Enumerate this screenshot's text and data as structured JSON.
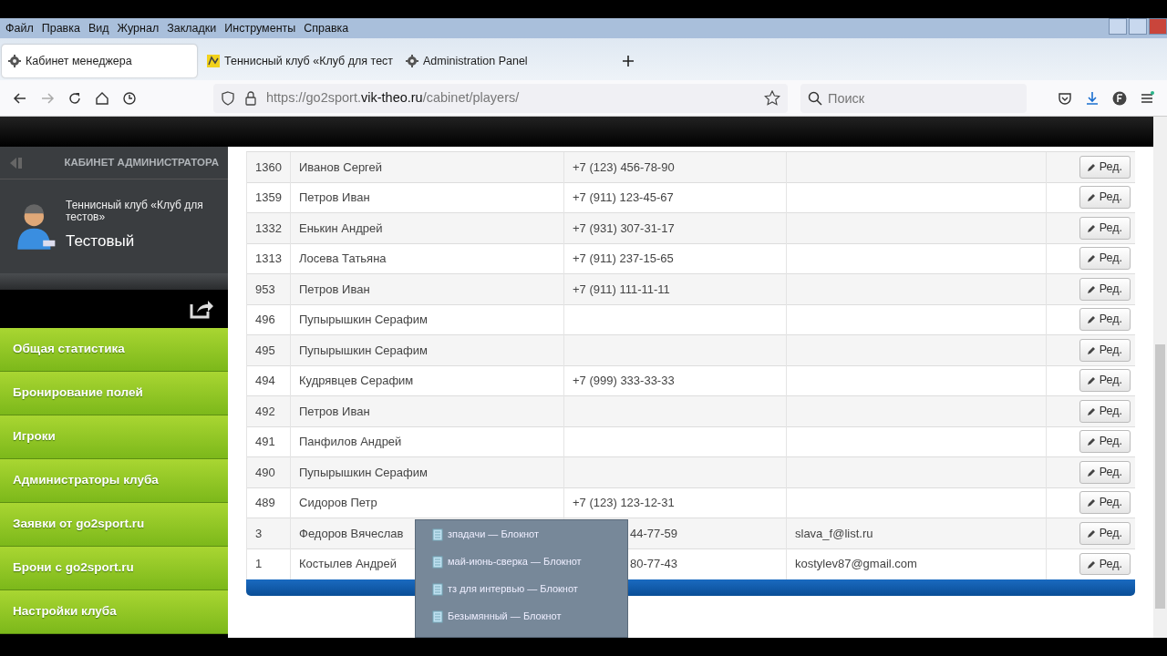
{
  "menu_bar": [
    "Файл",
    "Правка",
    "Вид",
    "Журнал",
    "Закладки",
    "Инструменты",
    "Справка"
  ],
  "tabs": [
    {
      "label": "Кабинет менеджера",
      "selected": true,
      "kind": "gear"
    },
    {
      "label": "Теннисный клуб «Клуб для тест",
      "selected": false,
      "kind": "map"
    },
    {
      "label": "Administration Panel",
      "selected": false,
      "kind": "gear"
    }
  ],
  "address": {
    "prefix": "https://go2sport.",
    "domain": "vik-theo.ru",
    "path": "/cabinet/players/"
  },
  "search": {
    "placeholder": "Поиск"
  },
  "sidebar": {
    "header": "КАБИНЕТ АДМИНИСТРАТОРА",
    "club": "Теннисный клуб «Клуб для тестов»",
    "user": "Тестовый",
    "items": [
      "Общая статистика",
      "Бронирование полей",
      "Игроки",
      "Администраторы клуба",
      "Заявки от go2sport.ru",
      "Брони с go2sport.ru",
      "Настройки клуба"
    ]
  },
  "table": {
    "rows": [
      {
        "id": "1360",
        "name": "Иванов Сергей",
        "phone": "+7 (123) 456-78-90",
        "email": "",
        "action": "Ред."
      },
      {
        "id": "1359",
        "name": "Петров Иван",
        "phone": "+7 (911) 123-45-67",
        "email": "",
        "action": "Ред."
      },
      {
        "id": "1332",
        "name": "Енькин Андрей",
        "phone": "+7 (931) 307-31-17",
        "email": "",
        "action": "Ред."
      },
      {
        "id": "1313",
        "name": "Лосева Татьяна",
        "phone": "+7 (911) 237-15-65",
        "email": "",
        "action": "Ред."
      },
      {
        "id": "953",
        "name": "Петров Иван",
        "phone": "+7 (911) 111-11-11",
        "email": "",
        "action": "Ред."
      },
      {
        "id": "496",
        "name": "Пупырышкин Серафим",
        "phone": "",
        "email": "",
        "action": "Ред."
      },
      {
        "id": "495",
        "name": "Пупырышкин Серафим",
        "phone": "",
        "email": "",
        "action": "Ред."
      },
      {
        "id": "494",
        "name": "Кудрявцев Серафим",
        "phone": "+7 (999) 333-33-33",
        "email": "",
        "action": "Ред."
      },
      {
        "id": "492",
        "name": "Петров Иван",
        "phone": "",
        "email": "",
        "action": "Ред."
      },
      {
        "id": "491",
        "name": "Панфилов Андрей",
        "phone": "",
        "email": "",
        "action": "Ред."
      },
      {
        "id": "490",
        "name": "Пупырышкин Серафим",
        "phone": "",
        "email": "",
        "action": "Ред."
      },
      {
        "id": "489",
        "name": "Сидоров Петр",
        "phone": "+7 (123) 123-12-31",
        "email": "",
        "action": "Ред."
      },
      {
        "id": "3",
        "name": "Федоров Вячеслав",
        "phone": "44-77-59",
        "phone_partial": true,
        "email": "slava_f@list.ru",
        "action": "Ред."
      },
      {
        "id": "1",
        "name": "Костылев Андрей",
        "phone": "80-77-43",
        "phone_partial": true,
        "email": "kostylev87@gmail.com",
        "action": "Ред."
      }
    ]
  },
  "taskbar_popup": {
    "items": [
      "зпадачи — Блокнот",
      "май-июнь-сверка — Блокнот",
      "тз для интервью — Блокнот",
      "Безымянный — Блокнот"
    ]
  }
}
